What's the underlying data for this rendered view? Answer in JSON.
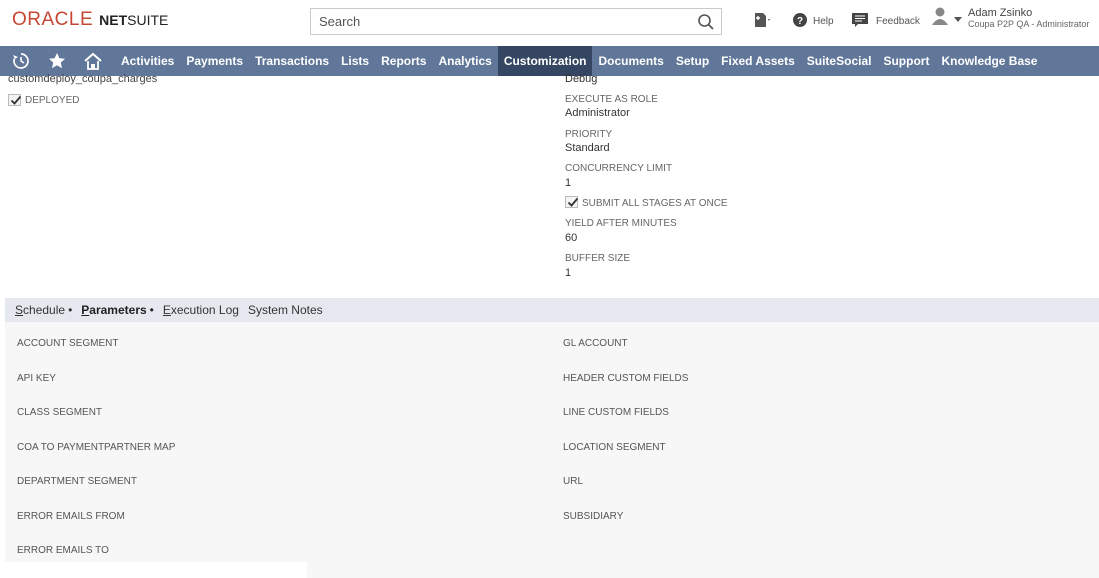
{
  "header": {
    "logo_oracle": "ORACLE",
    "logo_net": "NET",
    "logo_suite": "SUITE",
    "search_placeholder": "Search",
    "help_label": "Help",
    "feedback_label": "Feedback",
    "user_name": "Adam Zsinko",
    "user_role": "Coupa P2P QA - Administrator"
  },
  "nav": {
    "items": [
      "Activities",
      "Payments",
      "Transactions",
      "Lists",
      "Reports",
      "Analytics",
      "Customization",
      "Documents",
      "Setup",
      "Fixed Assets",
      "SuiteSocial",
      "Support",
      "Knowledge Base"
    ],
    "active": "Customization"
  },
  "form": {
    "script_id": "customdeploy_coupa_charges",
    "deployed_label": "DEPLOYED",
    "deployed_checked": true,
    "log_level_value": "Debug",
    "execute_as_role_label": "EXECUTE AS ROLE",
    "execute_as_role_value": "Administrator",
    "priority_label": "PRIORITY",
    "priority_value": "Standard",
    "concurrency_label": "CONCURRENCY LIMIT",
    "concurrency_value": "1",
    "submit_all_label": "SUBMIT ALL STAGES AT ONCE",
    "submit_all_checked": true,
    "yield_label": "YIELD AFTER MINUTES",
    "yield_value": "60",
    "buffer_label": "BUFFER SIZE",
    "buffer_value": "1"
  },
  "subtabs": [
    {
      "first": "S",
      "rest": "chedule",
      "dot": "•"
    },
    {
      "first": "P",
      "rest": "arameters",
      "dot": "•"
    },
    {
      "first": "E",
      "rest": "xecution Log",
      "dot": ""
    },
    {
      "first": "",
      "rest": "System Notes",
      "dot": ""
    }
  ],
  "active_subtab": "Parameters",
  "params": {
    "left": [
      "ACCOUNT SEGMENT",
      "API KEY",
      "CLASS SEGMENT",
      "COA TO PAYMENTPARTNER MAP",
      "DEPARTMENT SEGMENT",
      "ERROR EMAILS FROM",
      "ERROR EMAILS TO"
    ],
    "right": [
      "GL ACCOUNT",
      "HEADER CUSTOM FIELDS",
      "LINE CUSTOM FIELDS",
      "LOCATION SEGMENT",
      "URL",
      "SUBSIDIARY"
    ]
  },
  "colors": {
    "nav_bg": "#607799",
    "nav_active": "#344661",
    "brand_red": "#c74634",
    "subtab_bg": "#e5e9ef"
  }
}
